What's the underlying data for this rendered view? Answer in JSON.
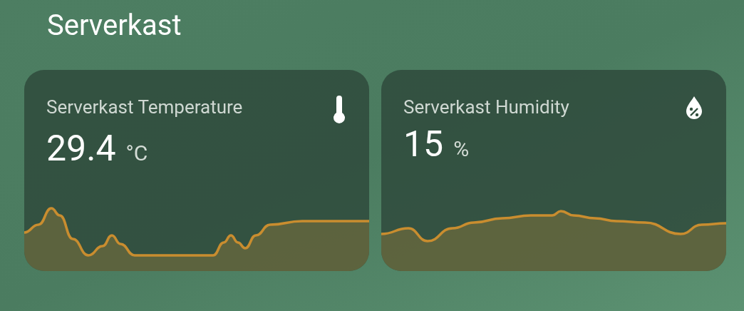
{
  "section_title": "Serverkast",
  "cards": [
    {
      "kind": "temperature",
      "name": "Serverkast Temperature",
      "value": "29.4",
      "unit": "°C"
    },
    {
      "kind": "humidity",
      "name": "Serverkast Humidity",
      "value": "15",
      "unit": "%"
    }
  ]
}
